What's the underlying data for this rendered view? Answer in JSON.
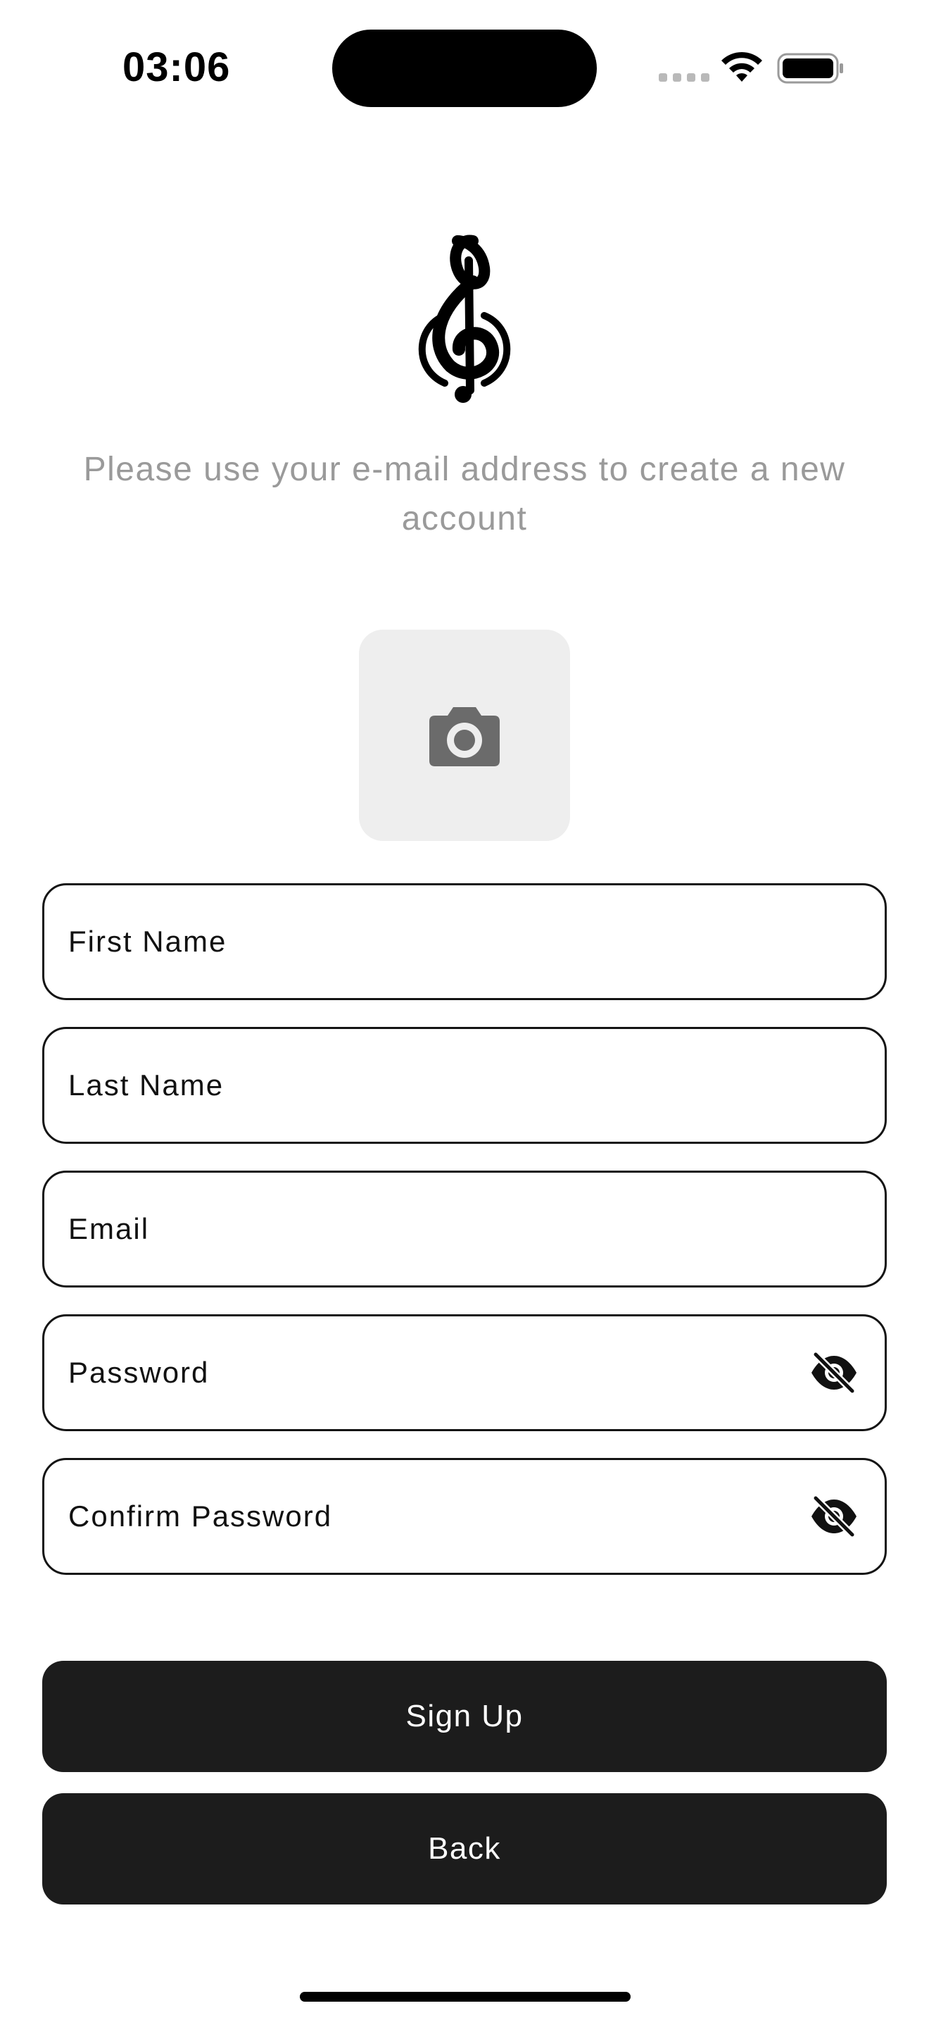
{
  "status_bar": {
    "time": "03:06"
  },
  "header": {
    "logo_icon": "treble-clef-icon",
    "subtitle": "Please use your e-mail address to create a new account"
  },
  "photo_picker": {
    "icon": "camera-icon"
  },
  "form": {
    "first_name": {
      "placeholder": "First Name",
      "value": ""
    },
    "last_name": {
      "placeholder": "Last Name",
      "value": ""
    },
    "email": {
      "placeholder": "Email",
      "value": ""
    },
    "password": {
      "placeholder": "Password",
      "value": "",
      "visibility_icon": "eye-off-icon"
    },
    "confirm_password": {
      "placeholder": "Confirm Password",
      "value": "",
      "visibility_icon": "eye-off-icon"
    }
  },
  "buttons": {
    "sign_up": "Sign Up",
    "back": "Back"
  },
  "colors": {
    "button_bg": "#1c1c1c",
    "button_text": "#ffffff",
    "field_border": "#141414",
    "subtitle": "#9a9a9a",
    "photo_picker_bg": "#eeeeee",
    "camera_icon": "#6b6b6b"
  }
}
